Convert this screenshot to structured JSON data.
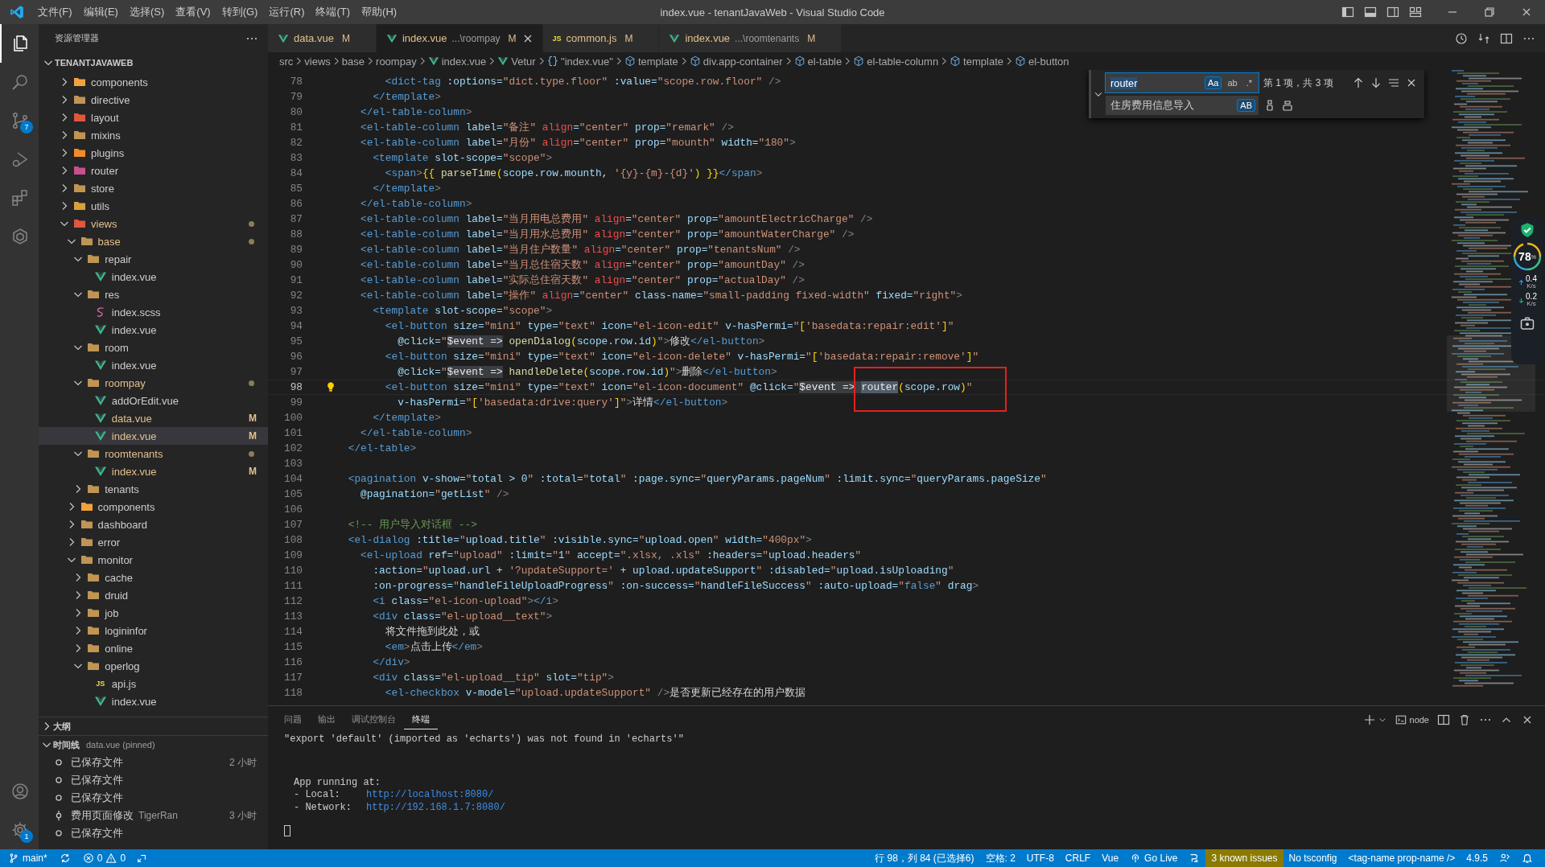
{
  "title_bar": {
    "menu": [
      "文件(F)",
      "编辑(E)",
      "选择(S)",
      "查看(V)",
      "转到(G)",
      "运行(R)",
      "终端(T)",
      "帮助(H)"
    ],
    "title": "index.vue - tenantJavaWeb - Visual Studio Code"
  },
  "activity_bar": {
    "items": [
      {
        "kind": "files",
        "selected": true
      },
      {
        "kind": "search",
        "selected": false
      },
      {
        "kind": "scm",
        "selected": false,
        "badge": "7"
      },
      {
        "kind": "debug",
        "selected": false
      },
      {
        "kind": "extensions",
        "selected": false
      },
      {
        "kind": "remote",
        "selected": false
      }
    ],
    "bottom": [
      {
        "kind": "account"
      },
      {
        "kind": "settings",
        "badge": "1"
      }
    ]
  },
  "sidebar": {
    "title": "资源管理器",
    "workspace": "TENANTJAVAWEB",
    "tree": [
      {
        "name": "components",
        "kind": "folder",
        "color": "#f1a33b",
        "expanded": false,
        "selected": false
      },
      {
        "name": "directive",
        "kind": "folder",
        "color": "#c09553",
        "expanded": false,
        "selected": false
      },
      {
        "name": "layout",
        "kind": "folder",
        "color": "#e0573e",
        "expanded": false,
        "selected": false
      },
      {
        "name": "mixins",
        "kind": "folder",
        "color": "#c09553",
        "expanded": false,
        "selected": false
      },
      {
        "name": "plugins",
        "kind": "folder",
        "color": "#f28c28",
        "expanded": false,
        "selected": false
      },
      {
        "name": "router",
        "kind": "folder",
        "color": "#c94f8f",
        "expanded": false,
        "selected": false
      },
      {
        "name": "store",
        "kind": "folder",
        "color": "#c09553",
        "expanded": false,
        "selected": false
      },
      {
        "name": "utils",
        "kind": "folder",
        "color": "#d9a03d",
        "expanded": false,
        "selected": false
      },
      {
        "name": "views",
        "kind": "folder",
        "color": "#e0573e",
        "expanded": true,
        "selected": false,
        "dot": true,
        "children": [
          {
            "name": "base",
            "kind": "folder",
            "color": "#c09553",
            "expanded": true,
            "selected": false,
            "dot": true,
            "children": [
              {
                "name": "repair",
                "kind": "folder",
                "color": "#c09553",
                "expanded": true,
                "selected": false,
                "children": [
                  {
                    "name": "index.vue",
                    "kind": "vue",
                    "selected": false
                  }
                ]
              },
              {
                "name": "res",
                "kind": "folder",
                "color": "#c09553",
                "expanded": true,
                "selected": false,
                "children": [
                  {
                    "name": "index.scss",
                    "kind": "scss",
                    "selected": false
                  },
                  {
                    "name": "index.vue",
                    "kind": "vue",
                    "selected": false
                  }
                ]
              },
              {
                "name": "room",
                "kind": "folder",
                "color": "#c09553",
                "expanded": true,
                "selected": false,
                "children": [
                  {
                    "name": "index.vue",
                    "kind": "vue",
                    "selected": false
                  }
                ]
              },
              {
                "name": "roompay",
                "kind": "folder",
                "color": "#c09553",
                "expanded": true,
                "selected": false,
                "dot": true,
                "children": [
                  {
                    "name": "addOrEdit.vue",
                    "kind": "vue",
                    "selected": false
                  },
                  {
                    "name": "data.vue",
                    "kind": "vue",
                    "selected": false,
                    "git": "M"
                  },
                  {
                    "name": "index.vue",
                    "kind": "vue",
                    "selected": true,
                    "git": "M"
                  }
                ]
              },
              {
                "name": "roomtenants",
                "kind": "folder",
                "color": "#c09553",
                "expanded": true,
                "selected": false,
                "dot": true,
                "children": [
                  {
                    "name": "index.vue",
                    "kind": "vue",
                    "selected": false,
                    "git": "M"
                  }
                ]
              },
              {
                "name": "tenants",
                "kind": "folder",
                "color": "#c09553",
                "expanded": false,
                "selected": false
              }
            ]
          },
          {
            "name": "components",
            "kind": "folder",
            "color": "#f1a33b",
            "expanded": false,
            "selected": false
          },
          {
            "name": "dashboard",
            "kind": "folder",
            "color": "#c09553",
            "expanded": false,
            "selected": false
          },
          {
            "name": "error",
            "kind": "folder",
            "color": "#c09553",
            "expanded": false,
            "selected": false
          },
          {
            "name": "monitor",
            "kind": "folder",
            "color": "#c09553",
            "expanded": true,
            "selected": false,
            "children": [
              {
                "name": "cache",
                "kind": "folder",
                "color": "#c09553",
                "expanded": false,
                "selected": false
              },
              {
                "name": "druid",
                "kind": "folder",
                "color": "#c09553",
                "expanded": false,
                "selected": false
              },
              {
                "name": "job",
                "kind": "folder",
                "color": "#c09553",
                "expanded": false,
                "selected": false
              },
              {
                "name": "logininfor",
                "kind": "folder",
                "color": "#c09553",
                "expanded": false,
                "selected": false
              },
              {
                "name": "online",
                "kind": "folder",
                "color": "#c09553",
                "expanded": false,
                "selected": false
              },
              {
                "name": "operlog",
                "kind": "folder",
                "color": "#c09553",
                "expanded": true,
                "selected": false,
                "children": [
                  {
                    "name": "api.js",
                    "kind": "js",
                    "icon_label": "JS",
                    "selected": false
                  },
                  {
                    "name": "index.vue",
                    "kind": "vue",
                    "selected": false
                  }
                ]
              }
            ]
          }
        ]
      }
    ],
    "outline": {
      "title": "大纲",
      "expanded": false
    },
    "timeline": {
      "title": "时间线",
      "subtitle": "data.vue (pinned)",
      "expanded": true,
      "items": [
        {
          "title": "已保存文件",
          "kind": "save",
          "time": "2 小时"
        },
        {
          "title": "已保存文件",
          "kind": "save"
        },
        {
          "title": "已保存文件",
          "kind": "save"
        },
        {
          "title": "费用页面修改",
          "kind": "commit",
          "author": "TigerRan",
          "time": "3 小时"
        },
        {
          "title": "已保存文件",
          "kind": "save"
        }
      ]
    }
  },
  "editor": {
    "tabs": [
      {
        "name": "data.vue",
        "kind": "vue",
        "git": "M",
        "selected": false
      },
      {
        "name": "index.vue",
        "kind": "vue",
        "path": "...\\roompay",
        "git": "M",
        "selected": true
      },
      {
        "name": "common.js",
        "kind": "js",
        "icon_label": "JS",
        "git": "M",
        "selected": false
      },
      {
        "name": "index.vue",
        "kind": "vue",
        "path": "...\\roomtenants",
        "git": "M",
        "selected": false
      }
    ],
    "breadcrumbs": [
      {
        "label": "src",
        "kind": "folder"
      },
      {
        "label": "views",
        "kind": "folder"
      },
      {
        "label": "base",
        "kind": "folder"
      },
      {
        "label": "roompay",
        "kind": "folder"
      },
      {
        "label": "index.vue",
        "kind": "vue"
      },
      {
        "label": "Vetur",
        "kind": "vue"
      },
      {
        "label": "\"index.vue\"",
        "kind": "module",
        "glyph": "{}"
      },
      {
        "label": "template",
        "kind": "element"
      },
      {
        "label": "div.app-container",
        "kind": "element"
      },
      {
        "label": "el-table",
        "kind": "element"
      },
      {
        "label": "el-table-column",
        "kind": "element"
      },
      {
        "label": "template",
        "kind": "element"
      },
      {
        "label": "el-button",
        "kind": "element"
      }
    ],
    "lines": [
      {
        "n": "78",
        "tokens": [
          {
            "kind": "tag",
            "text": "          <dict-tag"
          },
          {
            "kind": "attr",
            "text": " :options="
          },
          {
            "kind": "str",
            "text": "\"dict.type.floor\""
          },
          {
            "kind": "attr",
            "text": " :value="
          },
          {
            "kind": "str",
            "text": "\"scope.row.floor\""
          },
          {
            "kind": "punct",
            "text": " />"
          }
        ]
      },
      {
        "n": "79",
        "tokens": [
          {
            "kind": "tag",
            "text": "        </template"
          },
          {
            "kind": "punct",
            "text": ">"
          }
        ]
      },
      {
        "n": "80",
        "tokens": [
          {
            "kind": "tag",
            "text": "      </el-table-column"
          },
          {
            "kind": "punct",
            "text": ">"
          }
        ]
      },
      {
        "n": "81",
        "tokens": [
          {
            "kind": "tag",
            "text": "      <el-table-column"
          },
          {
            "kind": "attr",
            "text": " label="
          },
          {
            "kind": "str",
            "text": "\"备注\""
          },
          {
            "kind": "warn",
            "text": " align"
          },
          {
            "kind": "attr",
            "text": "="
          },
          {
            "kind": "str",
            "text": "\"center\""
          },
          {
            "kind": "attr",
            "text": " prop="
          },
          {
            "kind": "str",
            "text": "\"remark\""
          },
          {
            "kind": "punct",
            "text": " />"
          }
        ]
      },
      {
        "n": "82",
        "tokens": [
          {
            "kind": "tag",
            "text": "      <el-table-column"
          },
          {
            "kind": "attr",
            "text": " label="
          },
          {
            "kind": "str",
            "text": "\"月份\""
          },
          {
            "kind": "warn",
            "text": " align"
          },
          {
            "kind": "attr",
            "text": "="
          },
          {
            "kind": "str",
            "text": "\"center\""
          },
          {
            "kind": "attr",
            "text": " prop="
          },
          {
            "kind": "str",
            "text": "\"mounth\""
          },
          {
            "kind": "attr",
            "text": " width="
          },
          {
            "kind": "str",
            "text": "\"180\""
          },
          {
            "kind": "punct",
            "text": ">"
          }
        ]
      },
      {
        "n": "83",
        "tokens": [
          {
            "kind": "tag",
            "text": "        <template"
          },
          {
            "kind": "attr",
            "text": " slot-scope="
          },
          {
            "kind": "str",
            "text": "\"scope\""
          },
          {
            "kind": "punct",
            "text": ">"
          }
        ]
      },
      {
        "n": "84",
        "tokens": [
          {
            "kind": "tag",
            "text": "          <span"
          },
          {
            "kind": "punct",
            "text": ">"
          },
          {
            "kind": "brace",
            "text": "{{ "
          },
          {
            "kind": "func",
            "text": "parseTime"
          },
          {
            "kind": "brace",
            "text": "("
          },
          {
            "kind": "expr",
            "text": "scope.row.mounth"
          },
          {
            "kind": "text",
            "text": ", "
          },
          {
            "kind": "str",
            "text": "'{y}-{m}-{d}'"
          },
          {
            "kind": "brace",
            "text": ")"
          },
          {
            "kind": "brace",
            "text": " }}"
          },
          {
            "kind": "tag",
            "text": "</span"
          },
          {
            "kind": "punct",
            "text": ">"
          }
        ]
      },
      {
        "n": "85",
        "tokens": [
          {
            "kind": "tag",
            "text": "        </template"
          },
          {
            "kind": "punct",
            "text": ">"
          }
        ]
      },
      {
        "n": "86",
        "tokens": [
          {
            "kind": "tag",
            "text": "      </el-table-column"
          },
          {
            "kind": "punct",
            "text": ">"
          }
        ]
      },
      {
        "n": "87",
        "tokens": [
          {
            "kind": "tag",
            "text": "      <el-table-column"
          },
          {
            "kind": "attr",
            "text": " label="
          },
          {
            "kind": "str",
            "text": "\"当月用电总费用\""
          },
          {
            "kind": "warn",
            "text": " align"
          },
          {
            "kind": "attr",
            "text": "="
          },
          {
            "kind": "str",
            "text": "\"center\""
          },
          {
            "kind": "attr",
            "text": " prop="
          },
          {
            "kind": "str",
            "text": "\"amountElectricCharge\""
          },
          {
            "kind": "punct",
            "text": " />"
          }
        ]
      },
      {
        "n": "88",
        "tokens": [
          {
            "kind": "tag",
            "text": "      <el-table-column"
          },
          {
            "kind": "attr",
            "text": " label="
          },
          {
            "kind": "str",
            "text": "\"当月用水总费用\""
          },
          {
            "kind": "warn",
            "text": " align"
          },
          {
            "kind": "attr",
            "text": "="
          },
          {
            "kind": "str",
            "text": "\"center\""
          },
          {
            "kind": "attr",
            "text": " prop="
          },
          {
            "kind": "str",
            "text": "\"amountWaterCharge\""
          },
          {
            "kind": "punct",
            "text": " />"
          }
        ]
      },
      {
        "n": "89",
        "tokens": [
          {
            "kind": "tag",
            "text": "      <el-table-column"
          },
          {
            "kind": "attr",
            "text": " label="
          },
          {
            "kind": "str",
            "text": "\"当月住户数量\""
          },
          {
            "kind": "warn",
            "text": " align"
          },
          {
            "kind": "attr",
            "text": "="
          },
          {
            "kind": "str",
            "text": "\"center\""
          },
          {
            "kind": "attr",
            "text": " prop="
          },
          {
            "kind": "str",
            "text": "\"tenantsNum\""
          },
          {
            "kind": "punct",
            "text": " />"
          }
        ]
      },
      {
        "n": "90",
        "tokens": [
          {
            "kind": "tag",
            "text": "      <el-table-column"
          },
          {
            "kind": "attr",
            "text": " label="
          },
          {
            "kind": "str",
            "text": "\"当月总住宿天数\""
          },
          {
            "kind": "warn",
            "text": " align"
          },
          {
            "kind": "attr",
            "text": "="
          },
          {
            "kind": "str",
            "text": "\"center\""
          },
          {
            "kind": "attr",
            "text": " prop="
          },
          {
            "kind": "str",
            "text": "\"amountDay\""
          },
          {
            "kind": "punct",
            "text": " />"
          }
        ]
      },
      {
        "n": "91",
        "tokens": [
          {
            "kind": "tag",
            "text": "      <el-table-column"
          },
          {
            "kind": "attr",
            "text": " label="
          },
          {
            "kind": "str",
            "text": "\"实际总住宿天数\""
          },
          {
            "kind": "warn",
            "text": " align"
          },
          {
            "kind": "attr",
            "text": "="
          },
          {
            "kind": "str",
            "text": "\"center\""
          },
          {
            "kind": "attr",
            "text": " prop="
          },
          {
            "kind": "str",
            "text": "\"actualDay\""
          },
          {
            "kind": "punct",
            "text": " />"
          }
        ]
      },
      {
        "n": "92",
        "tokens": [
          {
            "kind": "tag",
            "text": "      <el-table-column"
          },
          {
            "kind": "attr",
            "text": " label="
          },
          {
            "kind": "str",
            "text": "\"操作\""
          },
          {
            "kind": "warn",
            "text": " align"
          },
          {
            "kind": "attr",
            "text": "="
          },
          {
            "kind": "str",
            "text": "\"center\""
          },
          {
            "kind": "attr",
            "text": " class-name="
          },
          {
            "kind": "str",
            "text": "\"small-padding fixed-width\""
          },
          {
            "kind": "attr",
            "text": " fixed="
          },
          {
            "kind": "str",
            "text": "\"right\""
          },
          {
            "kind": "punct",
            "text": ">"
          }
        ]
      },
      {
        "n": "93",
        "tokens": [
          {
            "kind": "tag",
            "text": "        <template"
          },
          {
            "kind": "attr",
            "text": " slot-scope="
          },
          {
            "kind": "str",
            "text": "\"scope\""
          },
          {
            "kind": "punct",
            "text": ">"
          }
        ]
      },
      {
        "n": "94",
        "tokens": [
          {
            "kind": "tag",
            "text": "          <el-button"
          },
          {
            "kind": "attr",
            "text": " size="
          },
          {
            "kind": "str",
            "text": "\"mini\""
          },
          {
            "kind": "attr",
            "text": " type="
          },
          {
            "kind": "str",
            "text": "\"text\""
          },
          {
            "kind": "attr",
            "text": " icon="
          },
          {
            "kind": "str",
            "text": "\"el-icon-edit\""
          },
          {
            "kind": "attr",
            "text": " v-hasPermi="
          },
          {
            "kind": "str",
            "text": "\""
          },
          {
            "kind": "brace",
            "text": "["
          },
          {
            "kind": "str",
            "text": "'basedata:repair:edit'"
          },
          {
            "kind": "brace",
            "text": "]"
          },
          {
            "kind": "str",
            "text": "\""
          }
        ]
      },
      {
        "n": "95",
        "tokens": [
          {
            "kind": "attr",
            "text": "            @click="
          },
          {
            "kind": "str",
            "text": "\""
          },
          {
            "kind": "hl",
            "text": "$event =>"
          },
          {
            "kind": "func",
            "text": " openDialog"
          },
          {
            "kind": "brace",
            "text": "("
          },
          {
            "kind": "expr",
            "text": "scope.row.id"
          },
          {
            "kind": "brace",
            "text": ")"
          },
          {
            "kind": "str",
            "text": "\""
          },
          {
            "kind": "punct",
            "text": ">"
          },
          {
            "kind": "text",
            "text": "修改"
          },
          {
            "kind": "tag",
            "text": "</el-button"
          },
          {
            "kind": "punct",
            "text": ">"
          }
        ]
      },
      {
        "n": "96",
        "tokens": [
          {
            "kind": "tag",
            "text": "          <el-button"
          },
          {
            "kind": "attr",
            "text": " size="
          },
          {
            "kind": "str",
            "text": "\"mini\""
          },
          {
            "kind": "attr",
            "text": " type="
          },
          {
            "kind": "str",
            "text": "\"text\""
          },
          {
            "kind": "attr",
            "text": " icon="
          },
          {
            "kind": "str",
            "text": "\"el-icon-delete\""
          },
          {
            "kind": "attr",
            "text": " v-hasPermi="
          },
          {
            "kind": "str",
            "text": "\""
          },
          {
            "kind": "brace",
            "text": "["
          },
          {
            "kind": "str",
            "text": "'basedata:repair:remove'"
          },
          {
            "kind": "brace",
            "text": "]"
          },
          {
            "kind": "str",
            "text": "\""
          }
        ]
      },
      {
        "n": "97",
        "tokens": [
          {
            "kind": "attr",
            "text": "            @click="
          },
          {
            "kind": "str",
            "text": "\""
          },
          {
            "kind": "hl",
            "text": "$event =>"
          },
          {
            "kind": "func",
            "text": " handleDelete"
          },
          {
            "kind": "brace",
            "text": "("
          },
          {
            "kind": "expr",
            "text": "scope.row.id"
          },
          {
            "kind": "brace",
            "text": ")"
          },
          {
            "kind": "str",
            "text": "\""
          },
          {
            "kind": "punct",
            "text": ">"
          },
          {
            "kind": "text",
            "text": "删除"
          },
          {
            "kind": "tag",
            "text": "</el-button"
          },
          {
            "kind": "punct",
            "text": ">"
          }
        ]
      },
      {
        "n": "98",
        "current": true,
        "lightbulb": true,
        "framed": true,
        "tokens": [
          {
            "kind": "tag",
            "text": "          <el-button"
          },
          {
            "kind": "attr",
            "text": " size="
          },
          {
            "kind": "str",
            "text": "\"mini\""
          },
          {
            "kind": "attr",
            "text": " type="
          },
          {
            "kind": "str",
            "text": "\"text\""
          },
          {
            "kind": "attr",
            "text": " icon="
          },
          {
            "kind": "str",
            "text": "\"el-icon-document\""
          },
          {
            "kind": "attr",
            "text": " @click="
          },
          {
            "kind": "str",
            "text": "\""
          },
          {
            "kind": "hl",
            "text": "$event => "
          },
          {
            "kind": "match",
            "text": "router"
          },
          {
            "kind": "brace",
            "text": "("
          },
          {
            "kind": "expr",
            "text": "scope.row"
          },
          {
            "kind": "brace",
            "text": ")"
          },
          {
            "kind": "str",
            "text": "\""
          }
        ]
      },
      {
        "n": "99",
        "tokens": [
          {
            "kind": "attr",
            "text": "            v-hasPermi="
          },
          {
            "kind": "str",
            "text": "\""
          },
          {
            "kind": "brace",
            "text": "["
          },
          {
            "kind": "str",
            "text": "'basedata:drive:query'"
          },
          {
            "kind": "brace",
            "text": "]"
          },
          {
            "kind": "str",
            "text": "\""
          },
          {
            "kind": "punct",
            "text": ">"
          },
          {
            "kind": "text",
            "text": "详情"
          },
          {
            "kind": "tag",
            "text": "</el-button"
          },
          {
            "kind": "punct",
            "text": ">"
          }
        ]
      },
      {
        "n": "100",
        "tokens": [
          {
            "kind": "tag",
            "text": "        </template"
          },
          {
            "kind": "punct",
            "text": ">"
          }
        ]
      },
      {
        "n": "101",
        "tokens": [
          {
            "kind": "tag",
            "text": "      </el-table-column"
          },
          {
            "kind": "punct",
            "text": ">"
          }
        ]
      },
      {
        "n": "102",
        "tokens": [
          {
            "kind": "tag",
            "text": "    </el-table"
          },
          {
            "kind": "punct",
            "text": ">"
          }
        ]
      },
      {
        "n": "103"
      },
      {
        "n": "104",
        "tokens": [
          {
            "kind": "tag",
            "text": "    <pagination"
          },
          {
            "kind": "attr",
            "text": " v-show="
          },
          {
            "kind": "str",
            "text": "\""
          },
          {
            "kind": "expr",
            "text": "total > 0"
          },
          {
            "kind": "str",
            "text": "\""
          },
          {
            "kind": "attr",
            "text": " :total="
          },
          {
            "kind": "str",
            "text": "\""
          },
          {
            "kind": "expr",
            "text": "total"
          },
          {
            "kind": "str",
            "text": "\""
          },
          {
            "kind": "attr",
            "text": " :page.sync="
          },
          {
            "kind": "str",
            "text": "\""
          },
          {
            "kind": "expr",
            "text": "queryParams.pageNum"
          },
          {
            "kind": "str",
            "text": "\""
          },
          {
            "kind": "attr",
            "text": " :limit.sync="
          },
          {
            "kind": "str",
            "text": "\""
          },
          {
            "kind": "expr",
            "text": "queryParams.pageSize"
          },
          {
            "kind": "str",
            "text": "\""
          }
        ]
      },
      {
        "n": "105",
        "tokens": [
          {
            "kind": "attr",
            "text": "      @pagination="
          },
          {
            "kind": "str",
            "text": "\""
          },
          {
            "kind": "expr",
            "text": "getList"
          },
          {
            "kind": "str",
            "text": "\""
          },
          {
            "kind": "punct",
            "text": " />"
          }
        ]
      },
      {
        "n": "106"
      },
      {
        "n": "107",
        "tokens": [
          {
            "kind": "comment",
            "text": "    <!-- 用户导入对话框 -->"
          }
        ]
      },
      {
        "n": "108",
        "tokens": [
          {
            "kind": "tag",
            "text": "    <el-dialog"
          },
          {
            "kind": "attr",
            "text": " :title="
          },
          {
            "kind": "str",
            "text": "\""
          },
          {
            "kind": "expr",
            "text": "upload.title"
          },
          {
            "kind": "str",
            "text": "\""
          },
          {
            "kind": "attr",
            "text": " :visible.sync="
          },
          {
            "kind": "str",
            "text": "\""
          },
          {
            "kind": "expr",
            "text": "upload.open"
          },
          {
            "kind": "str",
            "text": "\""
          },
          {
            "kind": "attr",
            "text": " width="
          },
          {
            "kind": "str",
            "text": "\"400px\""
          },
          {
            "kind": "punct",
            "text": ">"
          }
        ]
      },
      {
        "n": "109",
        "tokens": [
          {
            "kind": "tag",
            "text": "      <el-upload"
          },
          {
            "kind": "attr",
            "text": " ref="
          },
          {
            "kind": "str",
            "text": "\"upload\""
          },
          {
            "kind": "attr",
            "text": " :limit="
          },
          {
            "kind": "str",
            "text": "\""
          },
          {
            "kind": "expr",
            "text": "1"
          },
          {
            "kind": "str",
            "text": "\""
          },
          {
            "kind": "attr",
            "text": " accept="
          },
          {
            "kind": "str",
            "text": "\".xlsx, .xls\""
          },
          {
            "kind": "attr",
            "text": " :headers="
          },
          {
            "kind": "str",
            "text": "\""
          },
          {
            "kind": "expr",
            "text": "upload.headers"
          },
          {
            "kind": "str",
            "text": "\""
          }
        ]
      },
      {
        "n": "110",
        "tokens": [
          {
            "kind": "attr",
            "text": "        :action="
          },
          {
            "kind": "str",
            "text": "\""
          },
          {
            "kind": "expr",
            "text": "upload.url + "
          },
          {
            "kind": "str",
            "text": "'?updateSupport='"
          },
          {
            "kind": "expr",
            "text": " + upload.updateSupport"
          },
          {
            "kind": "str",
            "text": "\""
          },
          {
            "kind": "attr",
            "text": " :disabled="
          },
          {
            "kind": "str",
            "text": "\""
          },
          {
            "kind": "expr",
            "text": "upload.isUploading"
          },
          {
            "kind": "str",
            "text": "\""
          }
        ]
      },
      {
        "n": "111",
        "tokens": [
          {
            "kind": "attr",
            "text": "        :on-progress="
          },
          {
            "kind": "str",
            "text": "\""
          },
          {
            "kind": "expr",
            "text": "handleFileUploadProgress"
          },
          {
            "kind": "str",
            "text": "\""
          },
          {
            "kind": "attr",
            "text": " :on-success="
          },
          {
            "kind": "str",
            "text": "\""
          },
          {
            "kind": "expr",
            "text": "handleFileSuccess"
          },
          {
            "kind": "str",
            "text": "\""
          },
          {
            "kind": "attr",
            "text": " :auto-upload="
          },
          {
            "kind": "str",
            "text": "\""
          },
          {
            "kind": "kw",
            "text": "false"
          },
          {
            "kind": "str",
            "text": "\""
          },
          {
            "kind": "attr",
            "text": " drag"
          },
          {
            "kind": "punct",
            "text": ">"
          }
        ]
      },
      {
        "n": "112",
        "tokens": [
          {
            "kind": "tag",
            "text": "        <i"
          },
          {
            "kind": "attr",
            "text": " class="
          },
          {
            "kind": "str",
            "text": "\"el-icon-upload\""
          },
          {
            "kind": "punct",
            "text": ">"
          },
          {
            "kind": "tag",
            "text": "</i"
          },
          {
            "kind": "punct",
            "text": ">"
          }
        ]
      },
      {
        "n": "113",
        "tokens": [
          {
            "kind": "tag",
            "text": "        <div"
          },
          {
            "kind": "attr",
            "text": " class="
          },
          {
            "kind": "str",
            "text": "\"el-upload__text\""
          },
          {
            "kind": "punct",
            "text": ">"
          }
        ]
      },
      {
        "n": "114",
        "tokens": [
          {
            "kind": "text",
            "text": "          将文件拖到此处，或"
          }
        ]
      },
      {
        "n": "115",
        "tokens": [
          {
            "kind": "tag",
            "text": "          <em"
          },
          {
            "kind": "punct",
            "text": ">"
          },
          {
            "kind": "text",
            "text": "点击上传"
          },
          {
            "kind": "tag",
            "text": "</em"
          },
          {
            "kind": "punct",
            "text": ">"
          }
        ]
      },
      {
        "n": "116",
        "tokens": [
          {
            "kind": "tag",
            "text": "        </div"
          },
          {
            "kind": "punct",
            "text": ">"
          }
        ]
      },
      {
        "n": "117",
        "tokens": [
          {
            "kind": "tag",
            "text": "        <div"
          },
          {
            "kind": "attr",
            "text": " class="
          },
          {
            "kind": "str",
            "text": "\"el-upload__tip\""
          },
          {
            "kind": "attr",
            "text": " slot="
          },
          {
            "kind": "str",
            "text": "\"tip\""
          },
          {
            "kind": "punct",
            "text": ">"
          }
        ]
      },
      {
        "n": "118",
        "tokens": [
          {
            "kind": "tag",
            "text": "          <el-checkbox"
          },
          {
            "kind": "attr",
            "text": " v-model="
          },
          {
            "kind": "str",
            "text": "\"upload.updateSupport\""
          },
          {
            "kind": "punct",
            "text": " />"
          },
          {
            "kind": "text",
            "text": "是否更新已经存在的用户数据"
          }
        ]
      }
    ],
    "find": {
      "expanded": true,
      "query": "router",
      "toggles": [
        {
          "label": "Aa",
          "on": true
        },
        {
          "label": "ab",
          "on": false
        },
        {
          "label": ".*",
          "on": false
        }
      ],
      "result": "第 1 项，共 3 项",
      "replace": "住房费用信息导入",
      "replace_toggle": {
        "label": "AB",
        "on": true
      }
    }
  },
  "monitor": {
    "percent": "78",
    "unit": "%",
    "up": "0.4",
    "up_unit": "K/s",
    "down": "0.2",
    "down_unit": "K/s"
  },
  "panel": {
    "tabs": [
      {
        "label": "问题",
        "selected": false
      },
      {
        "label": "输出",
        "selected": false
      },
      {
        "label": "调试控制台",
        "selected": false
      },
      {
        "label": "终端",
        "selected": true
      }
    ],
    "shell": "node",
    "terminal": [
      {
        "text": "\"export 'default' (imported as 'echarts') was not found in 'echarts'\""
      },
      {
        "text": "App running at:"
      },
      {
        "text": "- Local:",
        "link": "http://localhost:8080/"
      },
      {
        "text": "- Network:",
        "link": "http://192.168.1.7:8080/"
      }
    ]
  },
  "status_bar": {
    "branch": "main*",
    "errors": "0",
    "warnings": "0",
    "right": [
      {
        "kind": "text",
        "text": "行 98，列 84 (已选择6)"
      },
      {
        "kind": "text",
        "text": "空格: 2"
      },
      {
        "kind": "text",
        "text": "UTF-8"
      },
      {
        "kind": "text",
        "text": "CRLF"
      },
      {
        "kind": "text",
        "text": "Vue"
      },
      {
        "kind": "golive",
        "text": "Go Live"
      },
      {
        "kind": "prettier"
      },
      {
        "kind": "warning",
        "text": "3 known issues"
      },
      {
        "kind": "text",
        "text": "No tsconfig"
      },
      {
        "kind": "text",
        "text": "<tag-name prop-name />"
      },
      {
        "kind": "text",
        "text": "4.9.5"
      },
      {
        "kind": "feedback"
      },
      {
        "kind": "bell"
      }
    ]
  }
}
